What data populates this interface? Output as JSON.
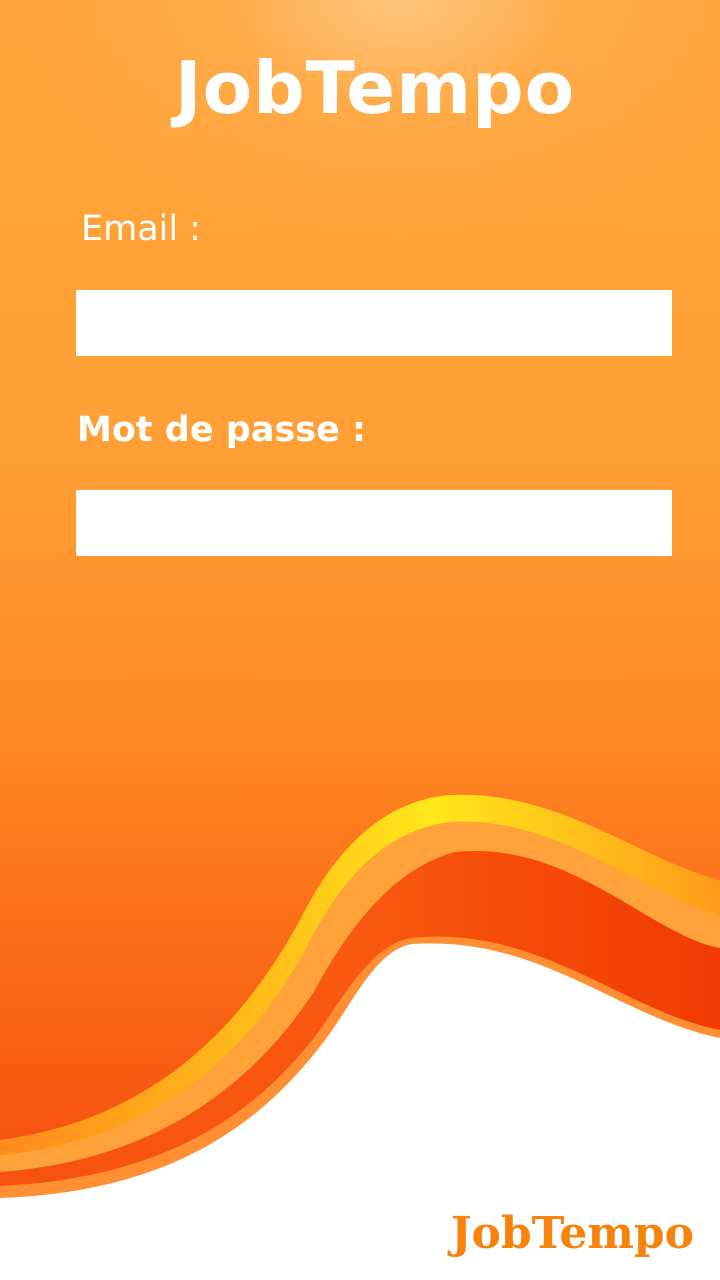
{
  "app": {
    "title": "JobTempo"
  },
  "login": {
    "email_label": "Email :",
    "email_value": "",
    "password_label": "Mot de passe :",
    "password_value": ""
  },
  "footer": {
    "brand": "JobTempo"
  },
  "colors": {
    "background_top": "#ffa43a",
    "background_bottom": "#f4480c",
    "wave_yellow": "#ffe81a",
    "wave_light_orange": "#ffa23a",
    "wave_deep_orange": "#f4470c",
    "footer_brand": "#f7830d",
    "text": "#ffffff",
    "input_background": "#ffffff"
  }
}
